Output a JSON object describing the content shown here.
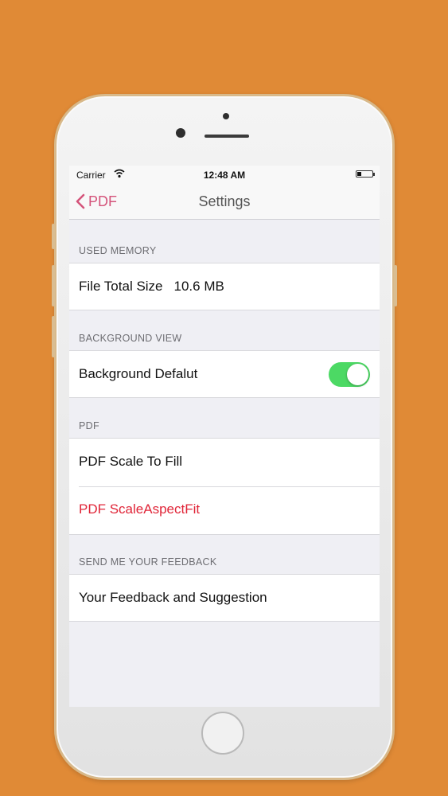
{
  "colors": {
    "background": "#E08A36",
    "accent": "#d4537a",
    "toggle_on": "#4cd964",
    "destructive": "#e02437"
  },
  "status_bar": {
    "carrier": "Carrier",
    "time": "12:48 AM"
  },
  "nav": {
    "back_label": "PDF",
    "title": "Settings"
  },
  "sections": {
    "used_memory": {
      "header": "USED MEMORY",
      "label": "File Total Size",
      "value": "10.6 MB"
    },
    "background_view": {
      "header": "BACKGROUND VIEW",
      "label": "Background Defalut",
      "toggle_on": true
    },
    "pdf": {
      "header": "PDF",
      "item1": "PDF Scale To Fill",
      "item2": "PDF ScaleAspectFit"
    },
    "feedback": {
      "header": "SEND ME YOUR FEEDBACK",
      "label": "Your Feedback and Suggestion"
    }
  }
}
